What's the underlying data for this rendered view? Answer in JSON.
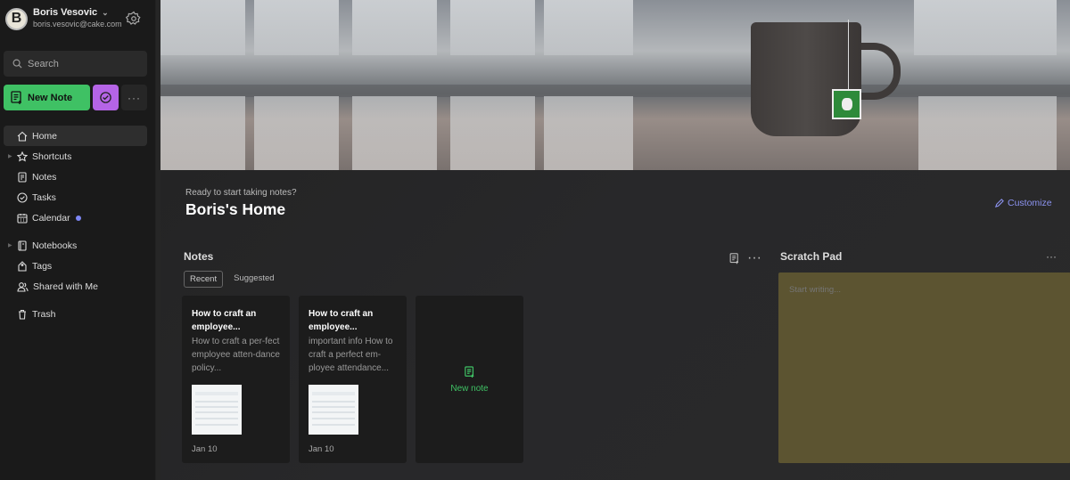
{
  "account": {
    "initial": "B",
    "name": "Boris Vesovic",
    "email": "boris.vesovic@cake.com"
  },
  "search": {
    "placeholder": "Search"
  },
  "actions": {
    "new_note": "New Note",
    "more": "···"
  },
  "nav": [
    {
      "label": "Home",
      "icon": "home-icon",
      "active": true
    },
    {
      "label": "Shortcuts",
      "icon": "star-icon",
      "caret": true
    },
    {
      "label": "Notes",
      "icon": "note-icon"
    },
    {
      "label": "Tasks",
      "icon": "check-circle-icon"
    },
    {
      "label": "Calendar",
      "icon": "calendar-icon",
      "dot": true
    },
    {
      "label": "Notebooks",
      "icon": "notebook-icon",
      "caret": true
    },
    {
      "label": "Tags",
      "icon": "tag-icon"
    },
    {
      "label": "Shared with Me",
      "icon": "people-icon"
    },
    {
      "label": "Trash",
      "icon": "trash-icon"
    }
  ],
  "home": {
    "greeting": "Ready to start taking notes?",
    "title": "Boris's Home",
    "customize": "Customize"
  },
  "notes": {
    "heading": "Notes",
    "more": "···",
    "tabs": [
      {
        "label": "Recent",
        "active": true
      },
      {
        "label": "Suggested"
      }
    ],
    "cards": [
      {
        "title": "How to craft an employee...",
        "snippet": "How to craft a per-fect employee atten-dance policy...",
        "date": "Jan 10"
      },
      {
        "title": "How to craft an employee...",
        "snippet": "important info How to craft a perfect em-ployee attendance...",
        "date": "Jan 10"
      }
    ],
    "new_note": "New note"
  },
  "scratch": {
    "heading": "Scratch Pad",
    "more": "···",
    "placeholder": "Start writing..."
  },
  "colors": {
    "accent_green": "#3fc164",
    "accent_purple": "#b564e6",
    "link": "#8c93f0",
    "scratch_bg": "#5c5431"
  }
}
